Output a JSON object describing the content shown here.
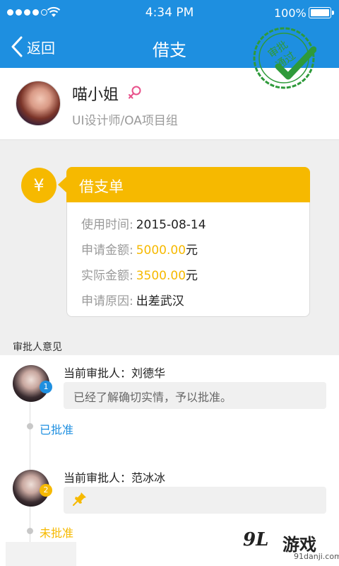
{
  "status_bar": {
    "time": "4:34 PM",
    "battery": "100%"
  },
  "nav": {
    "back_label": "返回",
    "title": "借支"
  },
  "profile": {
    "name": "喵小姐",
    "department": "UI设计师/OA项目组",
    "gender_icon": "female-icon",
    "stamp": {
      "line1": "审批",
      "line2": "通过",
      "color": "#2e9a3a"
    }
  },
  "loan": {
    "icon": "¥",
    "title": "借支单",
    "rows": {
      "use_time": {
        "label": "使用时间:",
        "value": "2015-08-14"
      },
      "requested": {
        "label": "申请金额:",
        "value": "5000.00",
        "unit": "元"
      },
      "actual": {
        "label": "实际金额:",
        "value": "3500.00",
        "unit": "元"
      },
      "reason": {
        "label": "申请原因:",
        "value": "出差武汉"
      }
    }
  },
  "approvals": {
    "section_title": "审批人意见",
    "items": [
      {
        "index": "1",
        "approver": "当前审批人：刘德华",
        "comment": "已经了解确切实情，予以批准。",
        "status": "已批准",
        "status_color": "#1e8fe0"
      },
      {
        "index": "2",
        "approver": "当前审批人：范冰冰",
        "comment": "",
        "comment_icon": "pin-icon",
        "status": "未批准",
        "status_color": "#f6b900"
      }
    ]
  },
  "watermark": {
    "logo": "9L",
    "text": "游戏",
    "url": "91danji.com"
  },
  "colors": {
    "primary": "#1e8fe0",
    "accent": "#f6b900",
    "muted_text": "#9a9a9a"
  }
}
